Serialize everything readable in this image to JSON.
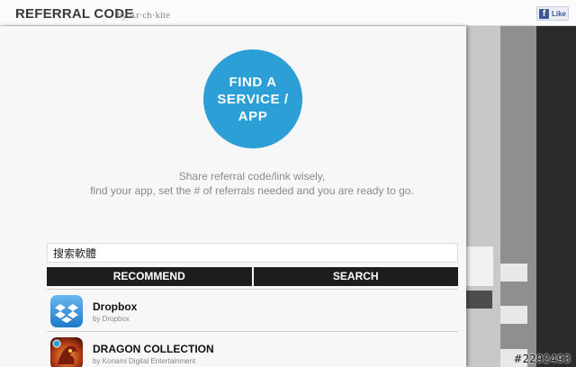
{
  "header": {
    "title": "REFERRAL CODE",
    "byline": "by Ar·ch·kite",
    "like_label": "Like",
    "like_icon": "facebook-icon"
  },
  "hero": {
    "button_label": "FIND A SERVICE / APP",
    "accent_color": "#2b9fd6"
  },
  "tagline": {
    "line1": "Share referral code/link wisely,",
    "line2": "find your app, set the # of referrals needed and you are ready to go."
  },
  "search": {
    "value": "搜索軟體",
    "placeholder": ""
  },
  "tabs": [
    {
      "label": "RECOMMEND"
    },
    {
      "label": "SEARCH"
    }
  ],
  "apps": [
    {
      "name": "Dropbox",
      "developer": "by Dropbox",
      "icon": "dropbox-icon"
    },
    {
      "name": "DRAGON COLLECTION",
      "developer": "by Konami Digital Entertainment",
      "icon": "dragon-collection-icon"
    }
  ],
  "watermark": "#2292493"
}
